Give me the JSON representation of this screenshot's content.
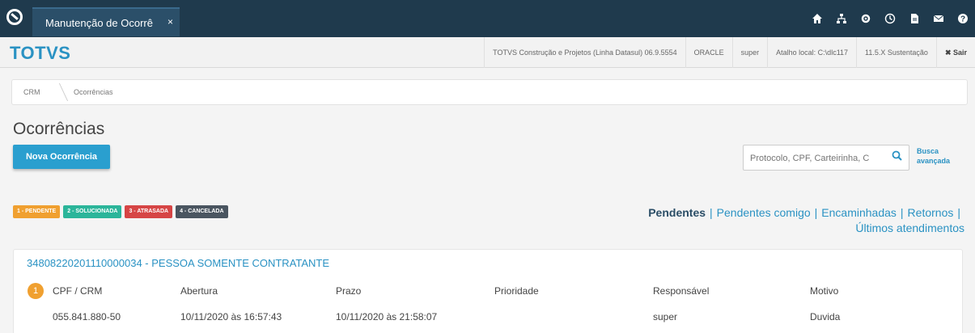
{
  "tab": {
    "label": "Manutenção de Ocorrê",
    "close": "×"
  },
  "toolbar_icons": [
    "home-icon",
    "sitemap-icon",
    "settings-icon",
    "clock-icon",
    "file-icon",
    "mail-icon",
    "help-icon"
  ],
  "brand": "TOTVS",
  "header_info": {
    "product": "TOTVS Construção e Projetos (Linha Datasul) 06.9.5554",
    "database": "ORACLE",
    "user": "super",
    "shortcut": "Atalho local: C:\\dlc117",
    "version": "11.5.X Sustentação",
    "exit": "✖ Sair"
  },
  "breadcrumb": {
    "crm": "CRM",
    "current": "Ocorrências"
  },
  "page_title": "Ocorrências",
  "new_button": "Nova Ocorrência",
  "search": {
    "placeholder": "Protocolo, CPF, Carteirinha, C",
    "advanced_line1": "Busca",
    "advanced_line2": "avançada"
  },
  "legend": [
    {
      "label": "1 - PENDENTE",
      "color": "#f0a030"
    },
    {
      "label": "2 - SOLUCIONADA",
      "color": "#2bb59a"
    },
    {
      "label": "3 - ATRASADA",
      "color": "#d64545"
    },
    {
      "label": "4 - CANCELADA",
      "color": "#4a5560"
    }
  ],
  "filters": {
    "pendentes": "Pendentes",
    "pendentes_comigo": "Pendentes comigo",
    "encaminhadas": "Encaminhadas",
    "retornos": "Retornos",
    "ultimos": "Últimos atendimentos",
    "separator": "|"
  },
  "occurrence": {
    "title": "34808220201110000034 - PESSOA SOMENTE CONTRATANTE",
    "badge": "1",
    "headers": {
      "cpf": "CPF / CRM",
      "abertura": "Abertura",
      "prazo": "Prazo",
      "prioridade": "Prioridade",
      "responsavel": "Responsável",
      "motivo": "Motivo"
    },
    "values": {
      "cpf": "055.841.880-50",
      "abertura": "10/11/2020 às 16:57:43",
      "prazo": "10/11/2020 às 21:58:07",
      "prioridade": "",
      "responsavel": "super",
      "motivo": "Duvida"
    }
  }
}
